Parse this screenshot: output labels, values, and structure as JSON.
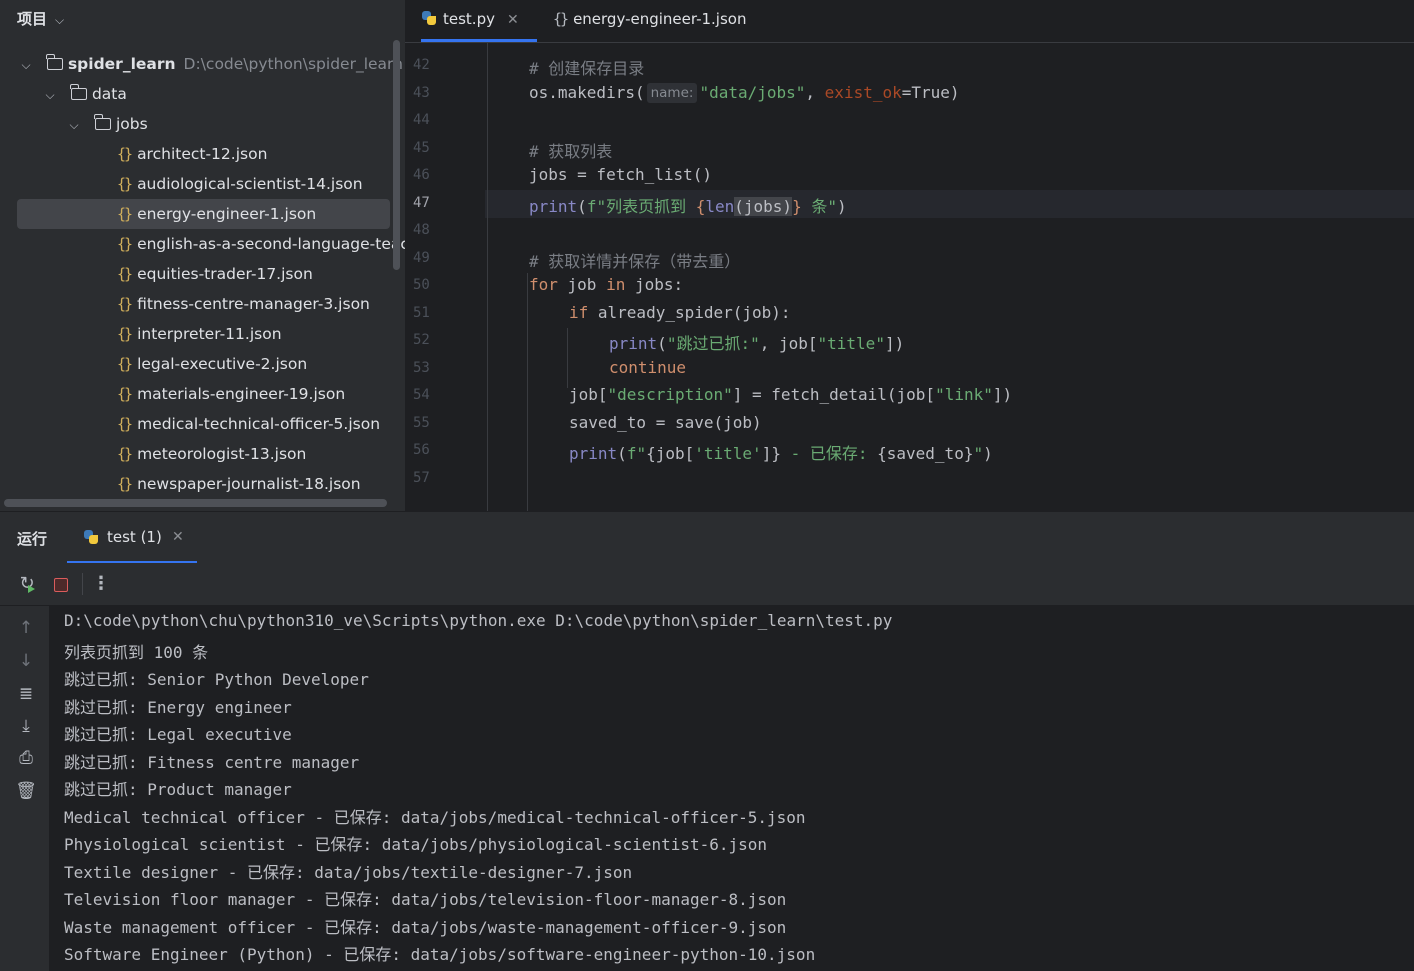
{
  "project": {
    "header": "项目",
    "root": {
      "name": "spider_learn",
      "path": "D:\\code\\python\\spider_learn"
    },
    "folders": [
      "data",
      "jobs"
    ],
    "files": [
      "architect-12.json",
      "audiological-scientist-14.json",
      "energy-engineer-1.json",
      "english-as-a-second-language-teach",
      "equities-trader-17.json",
      "fitness-centre-manager-3.json",
      "interpreter-11.json",
      "legal-executive-2.json",
      "materials-engineer-19.json",
      "medical-technical-officer-5.json",
      "meteorologist-13.json",
      "newspaper-journalist-18.json"
    ],
    "selected_file": "energy-engineer-1.json"
  },
  "editor": {
    "tabs": [
      {
        "label": "test.py",
        "icon": "python-icon",
        "active": true
      },
      {
        "label": "energy-engineer-1.json",
        "icon": "json-icon",
        "active": false
      }
    ],
    "current_line": "47",
    "line_numbers": [
      "42",
      "43",
      "44",
      "45",
      "46",
      "47",
      "48",
      "49",
      "50",
      "51",
      "52",
      "53",
      "54",
      "55",
      "56",
      "57"
    ],
    "code": {
      "l42_comment": "# 创建保存目录",
      "l43_a": "os.makedirs(",
      "l43_hint": "name:",
      "l43_str": "\"data/jobs\"",
      "l43_b": ", ",
      "l43_param": "exist_ok",
      "l43_c": "=True)",
      "l45_comment": "# 获取列表",
      "l46": "jobs = fetch_list()",
      "l47_print": "print",
      "l47_a": "(",
      "l47_str1": "f\"列表页抓到 ",
      "l47_brace1": "{",
      "l47_len": "len",
      "l47_b": "(jobs)",
      "l47_brace2": "}",
      "l47_str2": " 条\"",
      "l47_c": ")",
      "l49_comment": "# 获取详情并保存（带去重）",
      "l50_kw1": "for",
      "l50_a": " job ",
      "l50_kw2": "in",
      "l50_b": " jobs:",
      "l51_kw": "if",
      "l51_a": " already_spider(job):",
      "l52_print": "print",
      "l52_a": "(",
      "l52_str": "\"跳过已抓:\"",
      "l52_b": ", job[",
      "l52_key": "\"title\"",
      "l52_c": "])",
      "l53_kw": "continue",
      "l54_a": "job[",
      "l54_key": "\"description\"",
      "l54_b": "] = fetch_detail(job[",
      "l54_key2": "\"link\"",
      "l54_c": "])",
      "l55": "saved_to = save(job)",
      "l56_print": "print",
      "l56_a": "(",
      "l56_str1": "f\"",
      "l56_b": "{job[",
      "l56_key": "'title'",
      "l56_c": "]}",
      "l56_str2": " - 已保存: ",
      "l56_d": "{saved_to}",
      "l56_str3": "\"",
      "l56_e": ")"
    }
  },
  "run": {
    "title": "运行",
    "tab_label": "test (1)",
    "console": [
      "D:\\code\\python\\chu\\python310_ve\\Scripts\\python.exe D:\\code\\python\\spider_learn\\test.py",
      "列表页抓到 100 条",
      "跳过已抓: Senior Python Developer",
      "跳过已抓: Energy engineer",
      "跳过已抓: Legal executive",
      "跳过已抓: Fitness centre manager",
      "跳过已抓: Product manager",
      "Medical technical officer - 已保存: data/jobs/medical-technical-officer-5.json",
      "Physiological scientist - 已保存: data/jobs/physiological-scientist-6.json",
      "Textile designer - 已保存: data/jobs/textile-designer-7.json",
      "Television floor manager - 已保存: data/jobs/television-floor-manager-8.json",
      "Waste management officer - 已保存: data/jobs/waste-management-officer-9.json",
      "Software Engineer (Python) - 已保存: data/jobs/software-engineer-python-10.json"
    ]
  },
  "colors": {
    "accent": "#3574f0",
    "keyword": "#cf8e6d",
    "string": "#6aab73",
    "comment": "#7a7e85",
    "builtin": "#8888c6",
    "json_icon": "#d0ae5b"
  }
}
